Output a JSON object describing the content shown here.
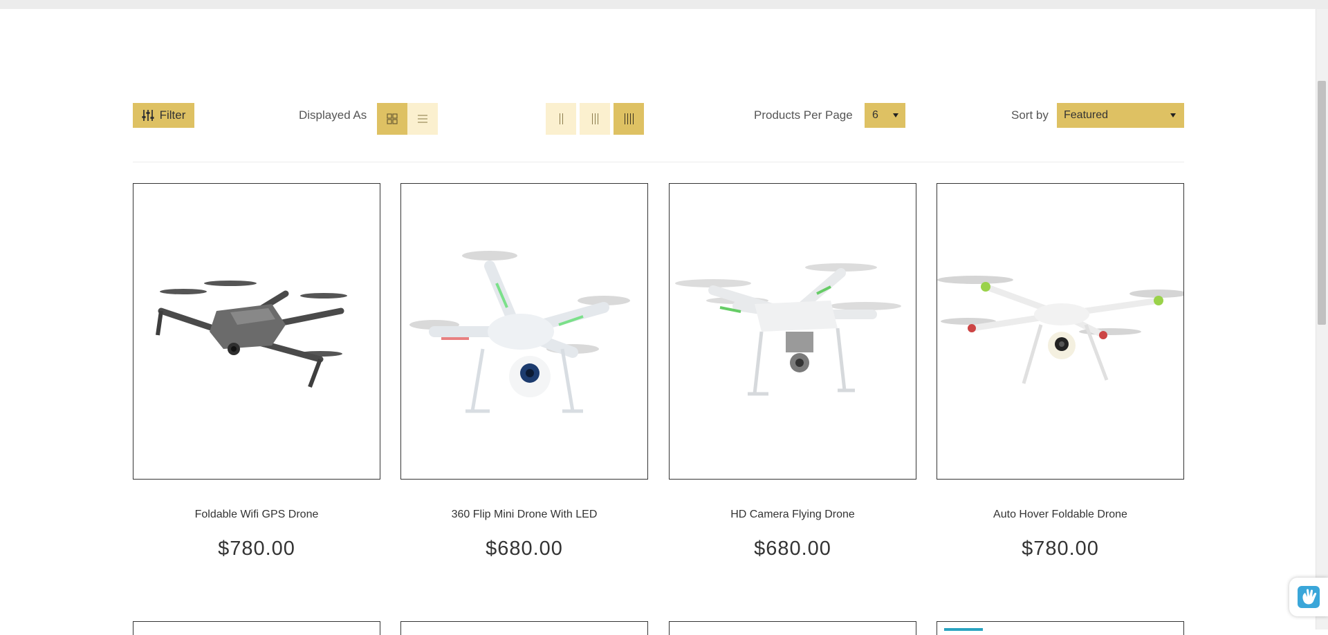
{
  "toolbar": {
    "filter_label": "Filter",
    "displayed_as_label": "Displayed As",
    "products_per_page_label": "Products Per Page",
    "products_per_page_value": "6",
    "sort_by_label": "Sort by",
    "sort_by_value": "Featured"
  },
  "colors": {
    "accent": "#dec163",
    "accent_light": "#fbf0cf",
    "text": "#333333"
  },
  "products": [
    {
      "title": "Foldable Wifi GPS Drone",
      "price": "$780.00",
      "image": "gray-foldable-drone"
    },
    {
      "title": "360 Flip Mini Drone With LED",
      "price": "$680.00",
      "image": "white-led-drone"
    },
    {
      "title": "HD Camera Flying Drone",
      "price": "$680.00",
      "image": "white-gimbal-drone"
    },
    {
      "title": "Auto Hover Foldable Drone",
      "price": "$780.00",
      "image": "white-hover-drone"
    }
  ]
}
